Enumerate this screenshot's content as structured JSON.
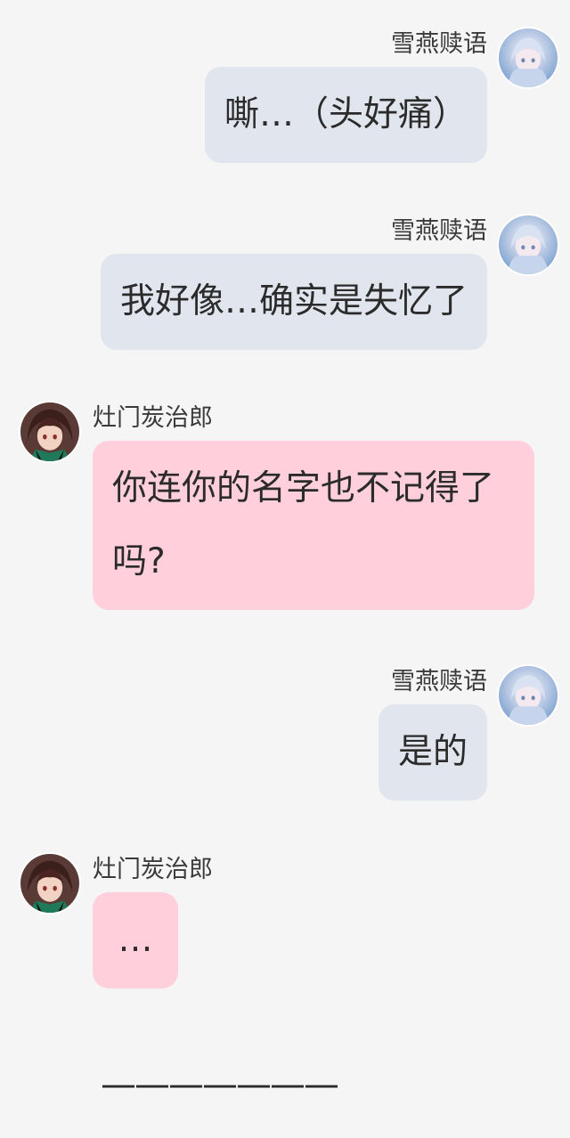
{
  "participants": {
    "self": {
      "name": "雪燕赎语",
      "avatar_icon": "anime-girl-avatar-icon"
    },
    "other": {
      "name": "灶门炭治郎",
      "avatar_icon": "tanjiro-avatar-icon"
    }
  },
  "messages": [
    {
      "sender": "雪燕赎语",
      "side": "right",
      "text": "嘶…（头好痛）"
    },
    {
      "sender": "雪燕赎语",
      "side": "right",
      "text": "我好像…确实是失忆了"
    },
    {
      "sender": "灶门炭治郎",
      "side": "left",
      "text": "你连你的名字也不记得了吗?"
    },
    {
      "sender": "雪燕赎语",
      "side": "right",
      "text": "是的"
    },
    {
      "sender": "灶门炭治郎",
      "side": "left",
      "text": "…"
    }
  ],
  "divider": "———————",
  "colors": {
    "background": "#f5f5f5",
    "self_bubble": "#e1e6ee",
    "other_bubble": "#ffd0dc",
    "text": "#2b2b2b"
  }
}
